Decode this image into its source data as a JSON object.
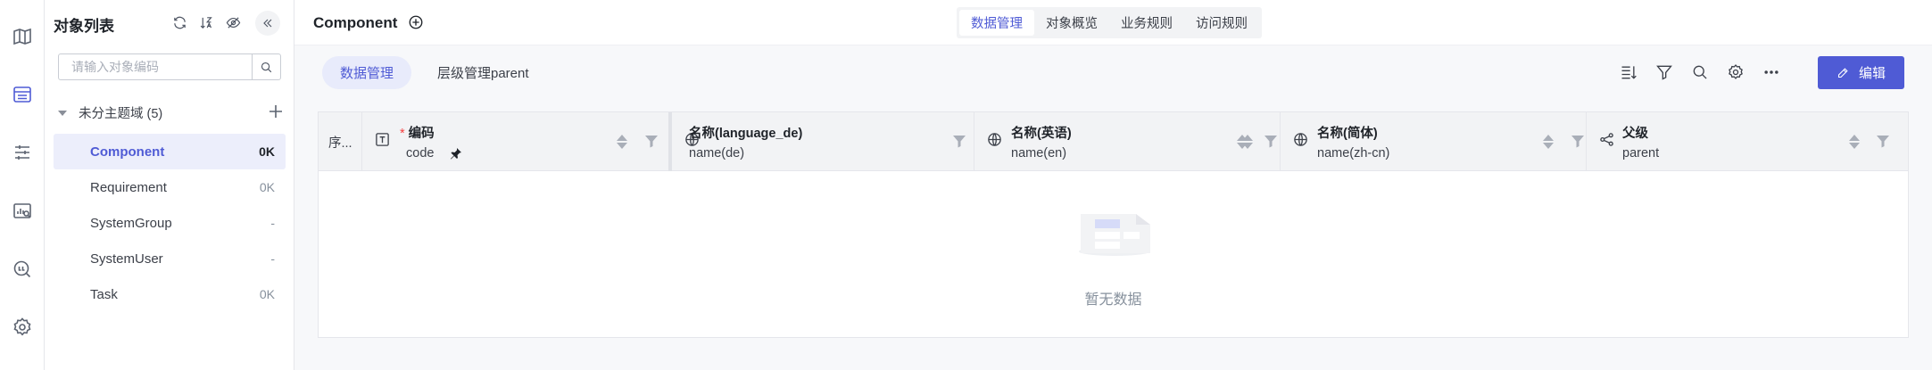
{
  "rail": {
    "items": [
      {
        "icon": "map-icon",
        "active": false
      },
      {
        "icon": "list-table-icon",
        "active": true
      },
      {
        "icon": "sliders-icon",
        "active": false
      },
      {
        "icon": "chart-search-icon",
        "active": false
      },
      {
        "icon": "ql-query-icon",
        "active": false
      },
      {
        "icon": "settings-icon",
        "active": false
      }
    ]
  },
  "panel": {
    "title": "对象列表",
    "search_placeholder": "请输入对象编码",
    "group_label": "未分主题域 (5)",
    "objects": [
      {
        "name": "Component",
        "count": "0K",
        "active": true
      },
      {
        "name": "Requirement",
        "count": "0K",
        "active": false
      },
      {
        "name": "SystemGroup",
        "count": "-",
        "active": false
      },
      {
        "name": "SystemUser",
        "count": "-",
        "active": false
      },
      {
        "name": "Task",
        "count": "0K",
        "active": false
      }
    ]
  },
  "header": {
    "title": "Component",
    "tabs": [
      {
        "label": "数据管理",
        "active": true
      },
      {
        "label": "对象概览",
        "active": false
      },
      {
        "label": "业务规则",
        "active": false
      },
      {
        "label": "访问规则",
        "active": false
      }
    ]
  },
  "subbar": {
    "tabs": [
      {
        "label": "数据管理",
        "active": true
      },
      {
        "label": "层级管理parent",
        "active": false
      }
    ],
    "edit_label": "编辑"
  },
  "table": {
    "seq_header": "序...",
    "columns": [
      {
        "name": "编码",
        "field": "code",
        "required": true,
        "icon": "text-field-icon"
      },
      {
        "name": "名称(language_de)",
        "field": "name(de)",
        "icon": "globe-icon"
      },
      {
        "name": "名称(英语)",
        "field": "name(en)",
        "icon": "globe-icon"
      },
      {
        "name": "名称(简体)",
        "field": "name(zh-cn)",
        "icon": "globe-icon"
      },
      {
        "name": "父级",
        "field": "parent",
        "icon": "share-node-icon"
      }
    ],
    "empty_text": "暂无数据"
  },
  "colors": {
    "accent": "#4f5bd5",
    "accent_bg": "#e8ebfb",
    "required": "#f53f3f"
  }
}
